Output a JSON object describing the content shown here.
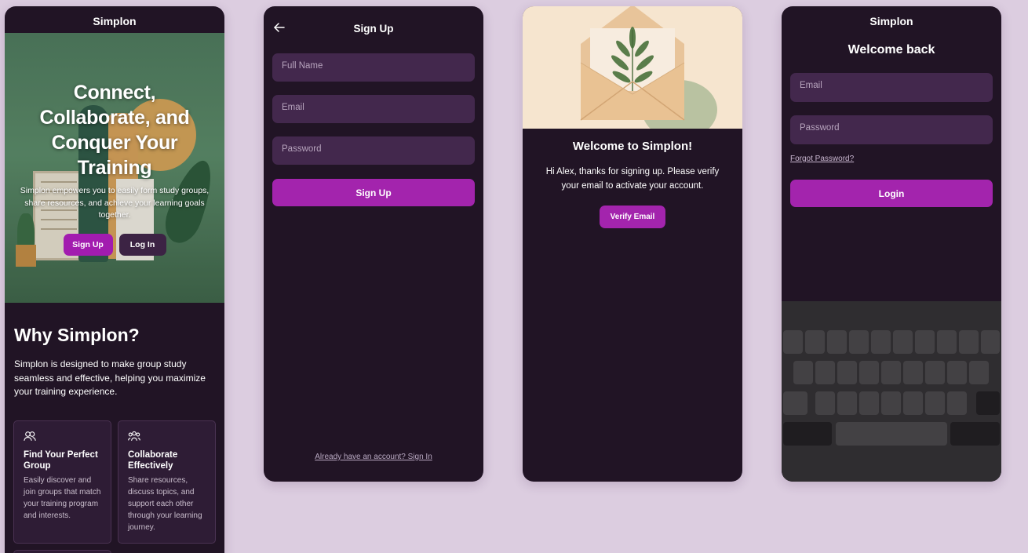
{
  "landing": {
    "app_name": "Simplon",
    "hero_title": "Connect, Collaborate, and Conquer Your Training",
    "hero_subtitle": "Simplon empowers you to easily form study groups, share resources, and achieve your learning goals together.",
    "signup_label": "Sign Up",
    "login_label": "Log In",
    "why_title": "Why Simplon?",
    "why_text": "Simplon is designed to make group study seamless and effective, helping you maximize your training experience.",
    "features": [
      {
        "icon": "users-icon",
        "title": "Find Your Perfect Group",
        "text": "Easily discover and join groups that match your training program and interests."
      },
      {
        "icon": "team-icon",
        "title": "Collaborate Effectively",
        "text": "Share resources, discuss topics, and support each other through your learning journey."
      }
    ]
  },
  "signup": {
    "title": "Sign Up",
    "full_name_placeholder": "Full Name",
    "email_placeholder": "Email",
    "password_placeholder": "Password",
    "submit_label": "Sign Up",
    "signin_link": "Already have an account? Sign In"
  },
  "welcome": {
    "title": "Welcome to Simplon!",
    "message": "Hi Alex, thanks for signing up. Please verify your email to activate your account.",
    "verify_label": "Verify Email"
  },
  "login": {
    "app_name": "Simplon",
    "title": "Welcome back",
    "email_placeholder": "Email",
    "password_placeholder": "Password",
    "forgot_label": "Forgot Password?",
    "submit_label": "Login"
  },
  "colors": {
    "background": "#dccde0",
    "phone": "#211425",
    "accent": "#a324ad",
    "field": "#43284d"
  }
}
